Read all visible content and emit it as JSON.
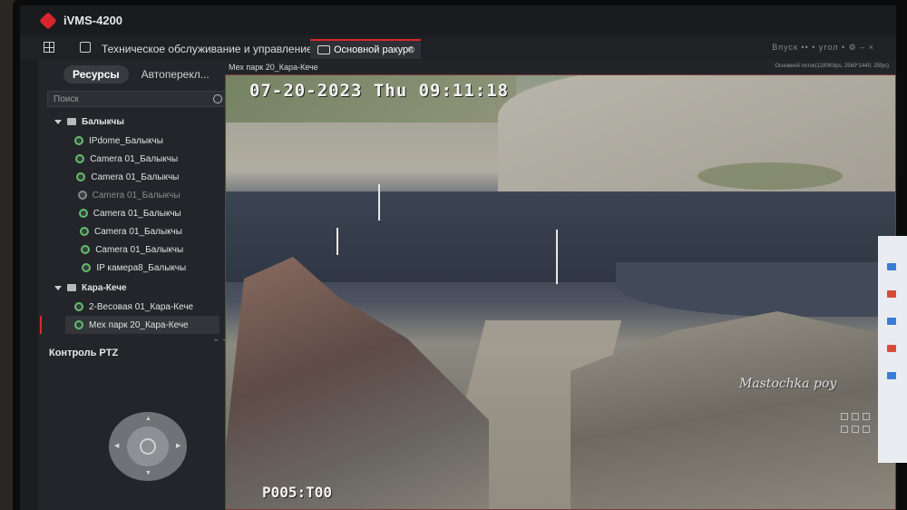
{
  "app": {
    "title": "iVMS-4200"
  },
  "nav": {
    "maintenance_label": "Техническое обслуживание и управление",
    "main_view_tab": "Основной ракурс",
    "right_hint": "Впуск ••  •  угол  •  ⚙  –  ×"
  },
  "sidebar": {
    "tab_resources": "Ресурсы",
    "tab_autoswitch": "Автоперекл...",
    "search_placeholder": "Поиск",
    "groups": [
      {
        "name": "Балыкчы",
        "cameras": [
          {
            "label": "IPdome_Балыкчы",
            "online": true
          },
          {
            "label": "Camera 01_Балыкчы",
            "online": true
          },
          {
            "label": "Camera 01_Балыкчы",
            "online": true
          },
          {
            "label": "Camera 01_Балыкчы",
            "online": false
          },
          {
            "label": "Camera 01_Балыкчы",
            "online": true
          },
          {
            "label": "Camera 01_Балыкчы",
            "online": true
          },
          {
            "label": "Camera 01_Балыкчы",
            "online": true
          },
          {
            "label": "IP камера8_Балыкчы",
            "online": true
          }
        ]
      },
      {
        "name": "Кара-Кече",
        "cameras": [
          {
            "label": "2-Весовая 01_Кара-Кече",
            "online": true
          },
          {
            "label": "Мех парк 20_Кара-Кече",
            "online": true,
            "selected": true
          }
        ]
      }
    ],
    "ptz_title": "Контроль PTZ"
  },
  "video": {
    "window_title": "Мех парк 20_Кара-Кече",
    "stream_info": "Основной поток(1280Kbps, 2560*1440, 25fps)",
    "osd_timestamp": "07-20-2023 Thu 09:11:18",
    "osd_camera_name": "Mastochka poy",
    "osd_ptz": "P005:T00"
  },
  "colors": {
    "accent": "#d8262c",
    "online": "#5fbf6a"
  }
}
